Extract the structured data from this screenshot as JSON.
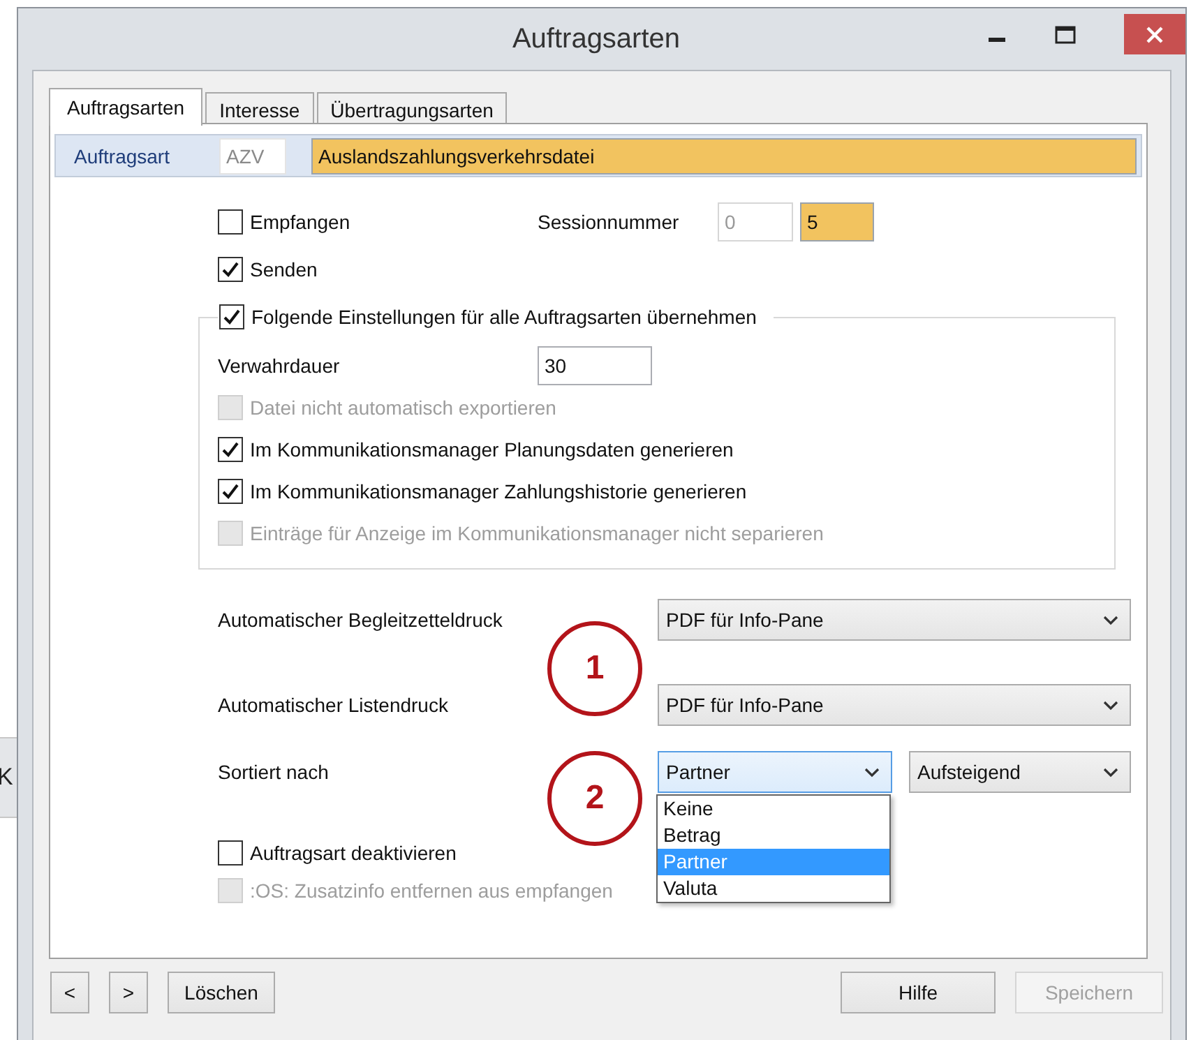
{
  "background_window": {
    "text": "K"
  },
  "window": {
    "title": "Auftragsarten"
  },
  "tabs": [
    {
      "label": "Auftragsarten",
      "selected": true
    },
    {
      "label": "Interesse",
      "selected": false
    },
    {
      "label": "Übertragungsarten",
      "selected": false
    }
  ],
  "header": {
    "label": "Auftragsart",
    "code": "AZV",
    "name": "Auslandszahlungsverkehrsdatei"
  },
  "options": [
    {
      "label": "Empfangen",
      "checked": false,
      "disabled": false
    },
    {
      "label": "Senden",
      "checked": true,
      "disabled": false
    }
  ],
  "session": {
    "label": "Sessionnummer",
    "fields": [
      {
        "value": "0",
        "highlighted": false
      },
      {
        "value": "5",
        "highlighted": true
      }
    ]
  },
  "group": {
    "legend": {
      "label": "Folgende Einstellungen für alle Auftragsarten übernehmen",
      "checked": true,
      "disabled": false
    },
    "retention": {
      "label": "Verwahrdauer",
      "value": "30"
    },
    "options": [
      {
        "label": "Datei nicht automatisch exportieren",
        "checked": false,
        "disabled": true
      },
      {
        "label": "Im Kommunikationsmanager Planungsdaten generieren",
        "checked": true,
        "disabled": false
      },
      {
        "label": "Im Kommunikationsmanager Zahlungshistorie generieren",
        "checked": true,
        "disabled": false
      },
      {
        "label": "Einträge für Anzeige im Kommunikationsmanager  nicht separieren",
        "checked": false,
        "disabled": true
      }
    ]
  },
  "selects": [
    {
      "label": "Automatischer Begleitzetteldruck",
      "value": "PDF für Info-Pane"
    },
    {
      "label": "Automatischer Listendruck",
      "value": "PDF für Info-Pane"
    }
  ],
  "sort": {
    "label": "Sortiert nach",
    "field": {
      "value": "Partner",
      "expanded": true,
      "options": [
        {
          "label": "Keine",
          "selected": false
        },
        {
          "label": "Betrag",
          "selected": false
        },
        {
          "label": "Partner",
          "selected": true
        },
        {
          "label": "Valuta",
          "selected": false
        }
      ]
    },
    "order": {
      "value": "Aufsteigend"
    }
  },
  "bottom_options": [
    {
      "label": "Auftragsart deaktivieren",
      "checked": false,
      "disabled": false
    },
    {
      "label": ":OS: Zusatzinfo entfernen aus empfangen",
      "checked": false,
      "disabled": true
    }
  ],
  "callouts": [
    "1",
    "2"
  ],
  "buttons_left": [
    {
      "label": "<",
      "disabled": false
    },
    {
      "label": ">",
      "disabled": false
    },
    {
      "label": "Löschen",
      "disabled": false
    }
  ],
  "buttons_right": [
    {
      "label": "Hilfe",
      "disabled": false
    },
    {
      "label": "Speichern",
      "disabled": true
    }
  ]
}
